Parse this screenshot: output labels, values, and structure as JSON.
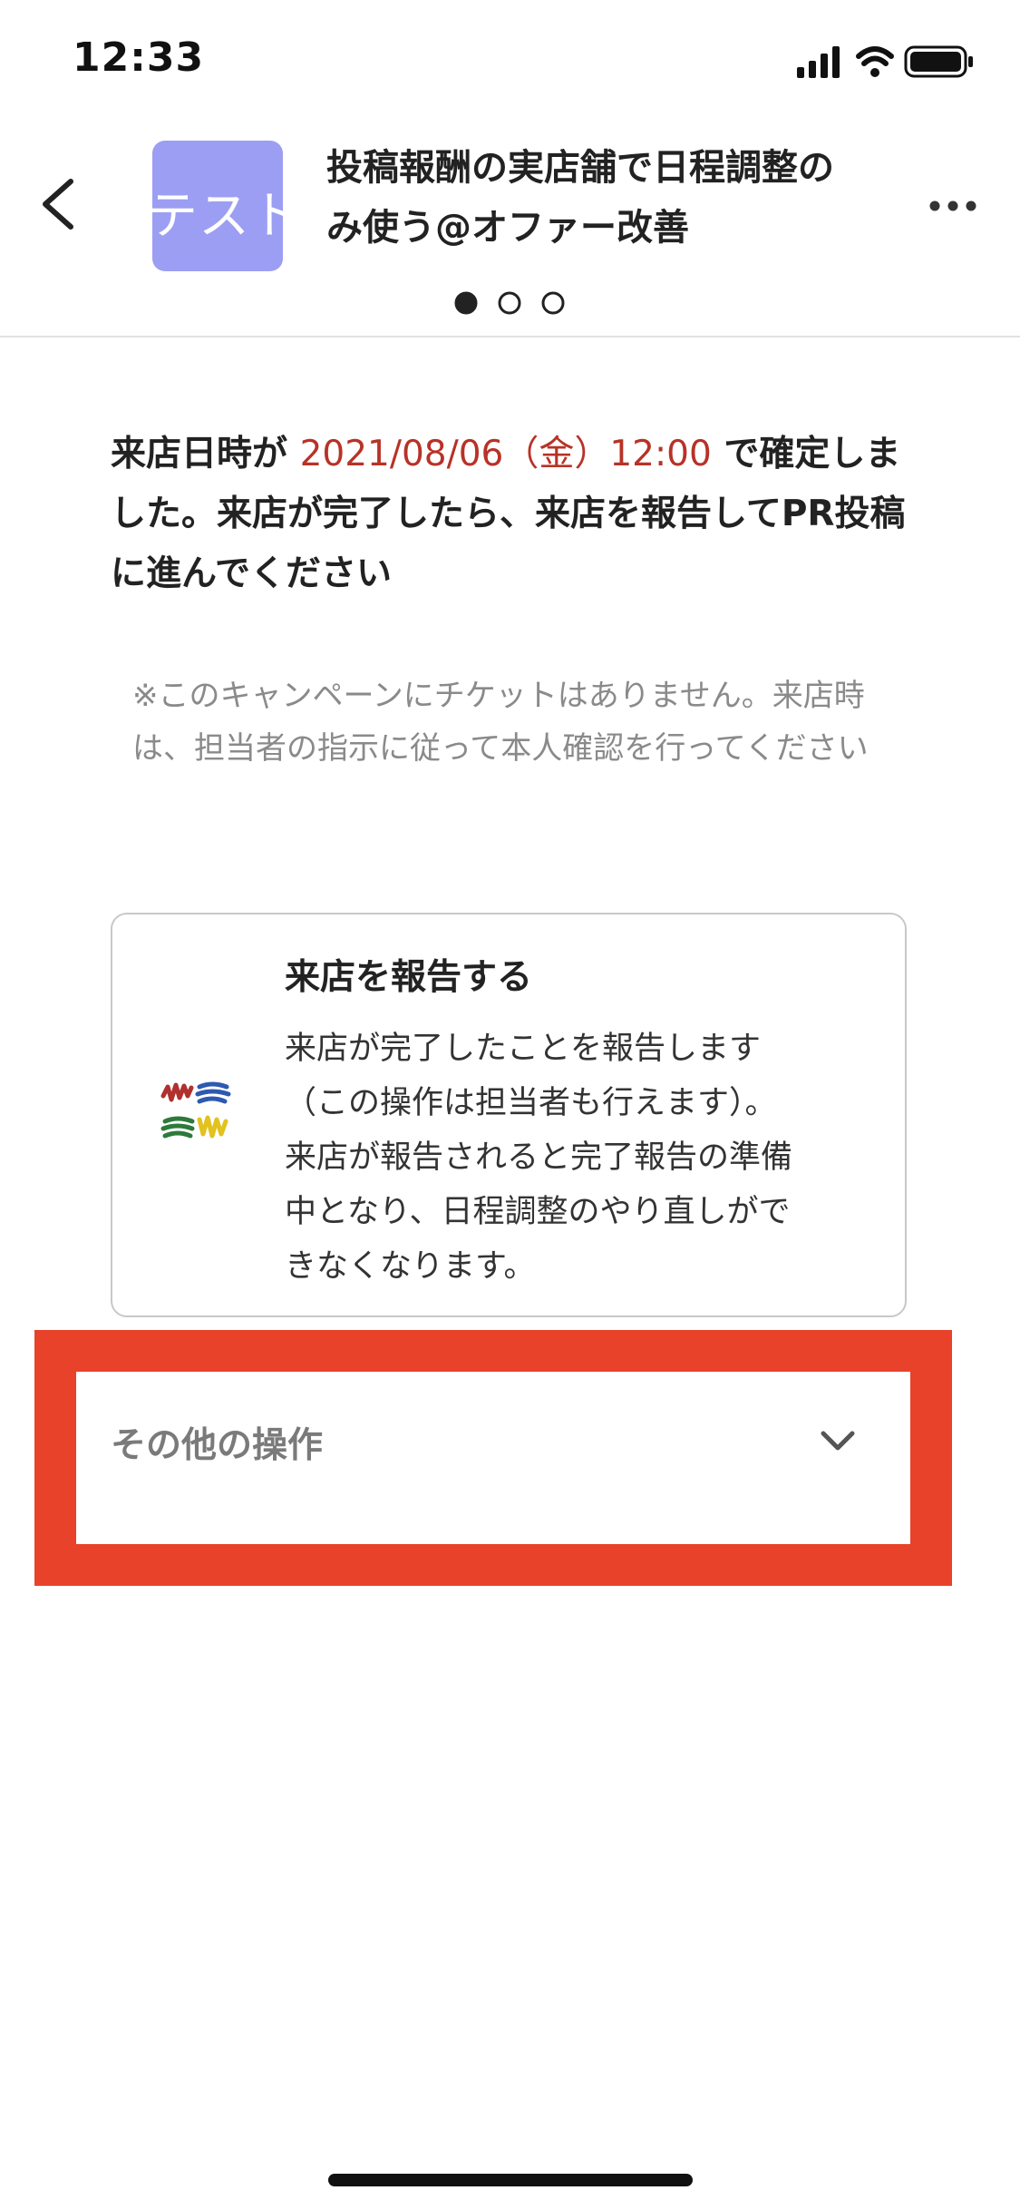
{
  "status_bar": {
    "time": "12:33",
    "icons": [
      "signal-icon",
      "wifi-icon",
      "battery-icon"
    ]
  },
  "header": {
    "back_icon": "chevron-left-icon",
    "thumbnail_text": "テスト",
    "thumbnail_color": "#9c9ef3",
    "title_line1": "投稿報酬の実店舗で日程調整の",
    "title_line2": "み使う@オファー改善",
    "more_icon": "ellipsis-icon",
    "pager": {
      "count": 3,
      "active_index": 0
    }
  },
  "message": {
    "prefix": "来店日時が ",
    "datetime": "2021/08/06（金）12:00",
    "suffix": " で確定しました。来店が完了したら、来店を報告してPR投稿に進んでください",
    "highlight_color": "#b83227",
    "note": "※このキャンペーンにチケットはありません。来店時は、担当者の指示に従って本人確認を行ってください"
  },
  "report_card": {
    "icon": "color-scribble-icon",
    "title": "来店を報告する",
    "description_line1": "来店が完了したことを報告します",
    "description_line2": "（この操作は担当者も行えます）。",
    "description_line3": "来店が報告されると完了報告の準備",
    "description_line4": "中となり、日程調整のやり直しがで",
    "description_line5": "きなくなります。"
  },
  "other_operations": {
    "label": "その他の操作",
    "icon": "chevron-down-icon",
    "highlight_color": "#e8422a"
  }
}
